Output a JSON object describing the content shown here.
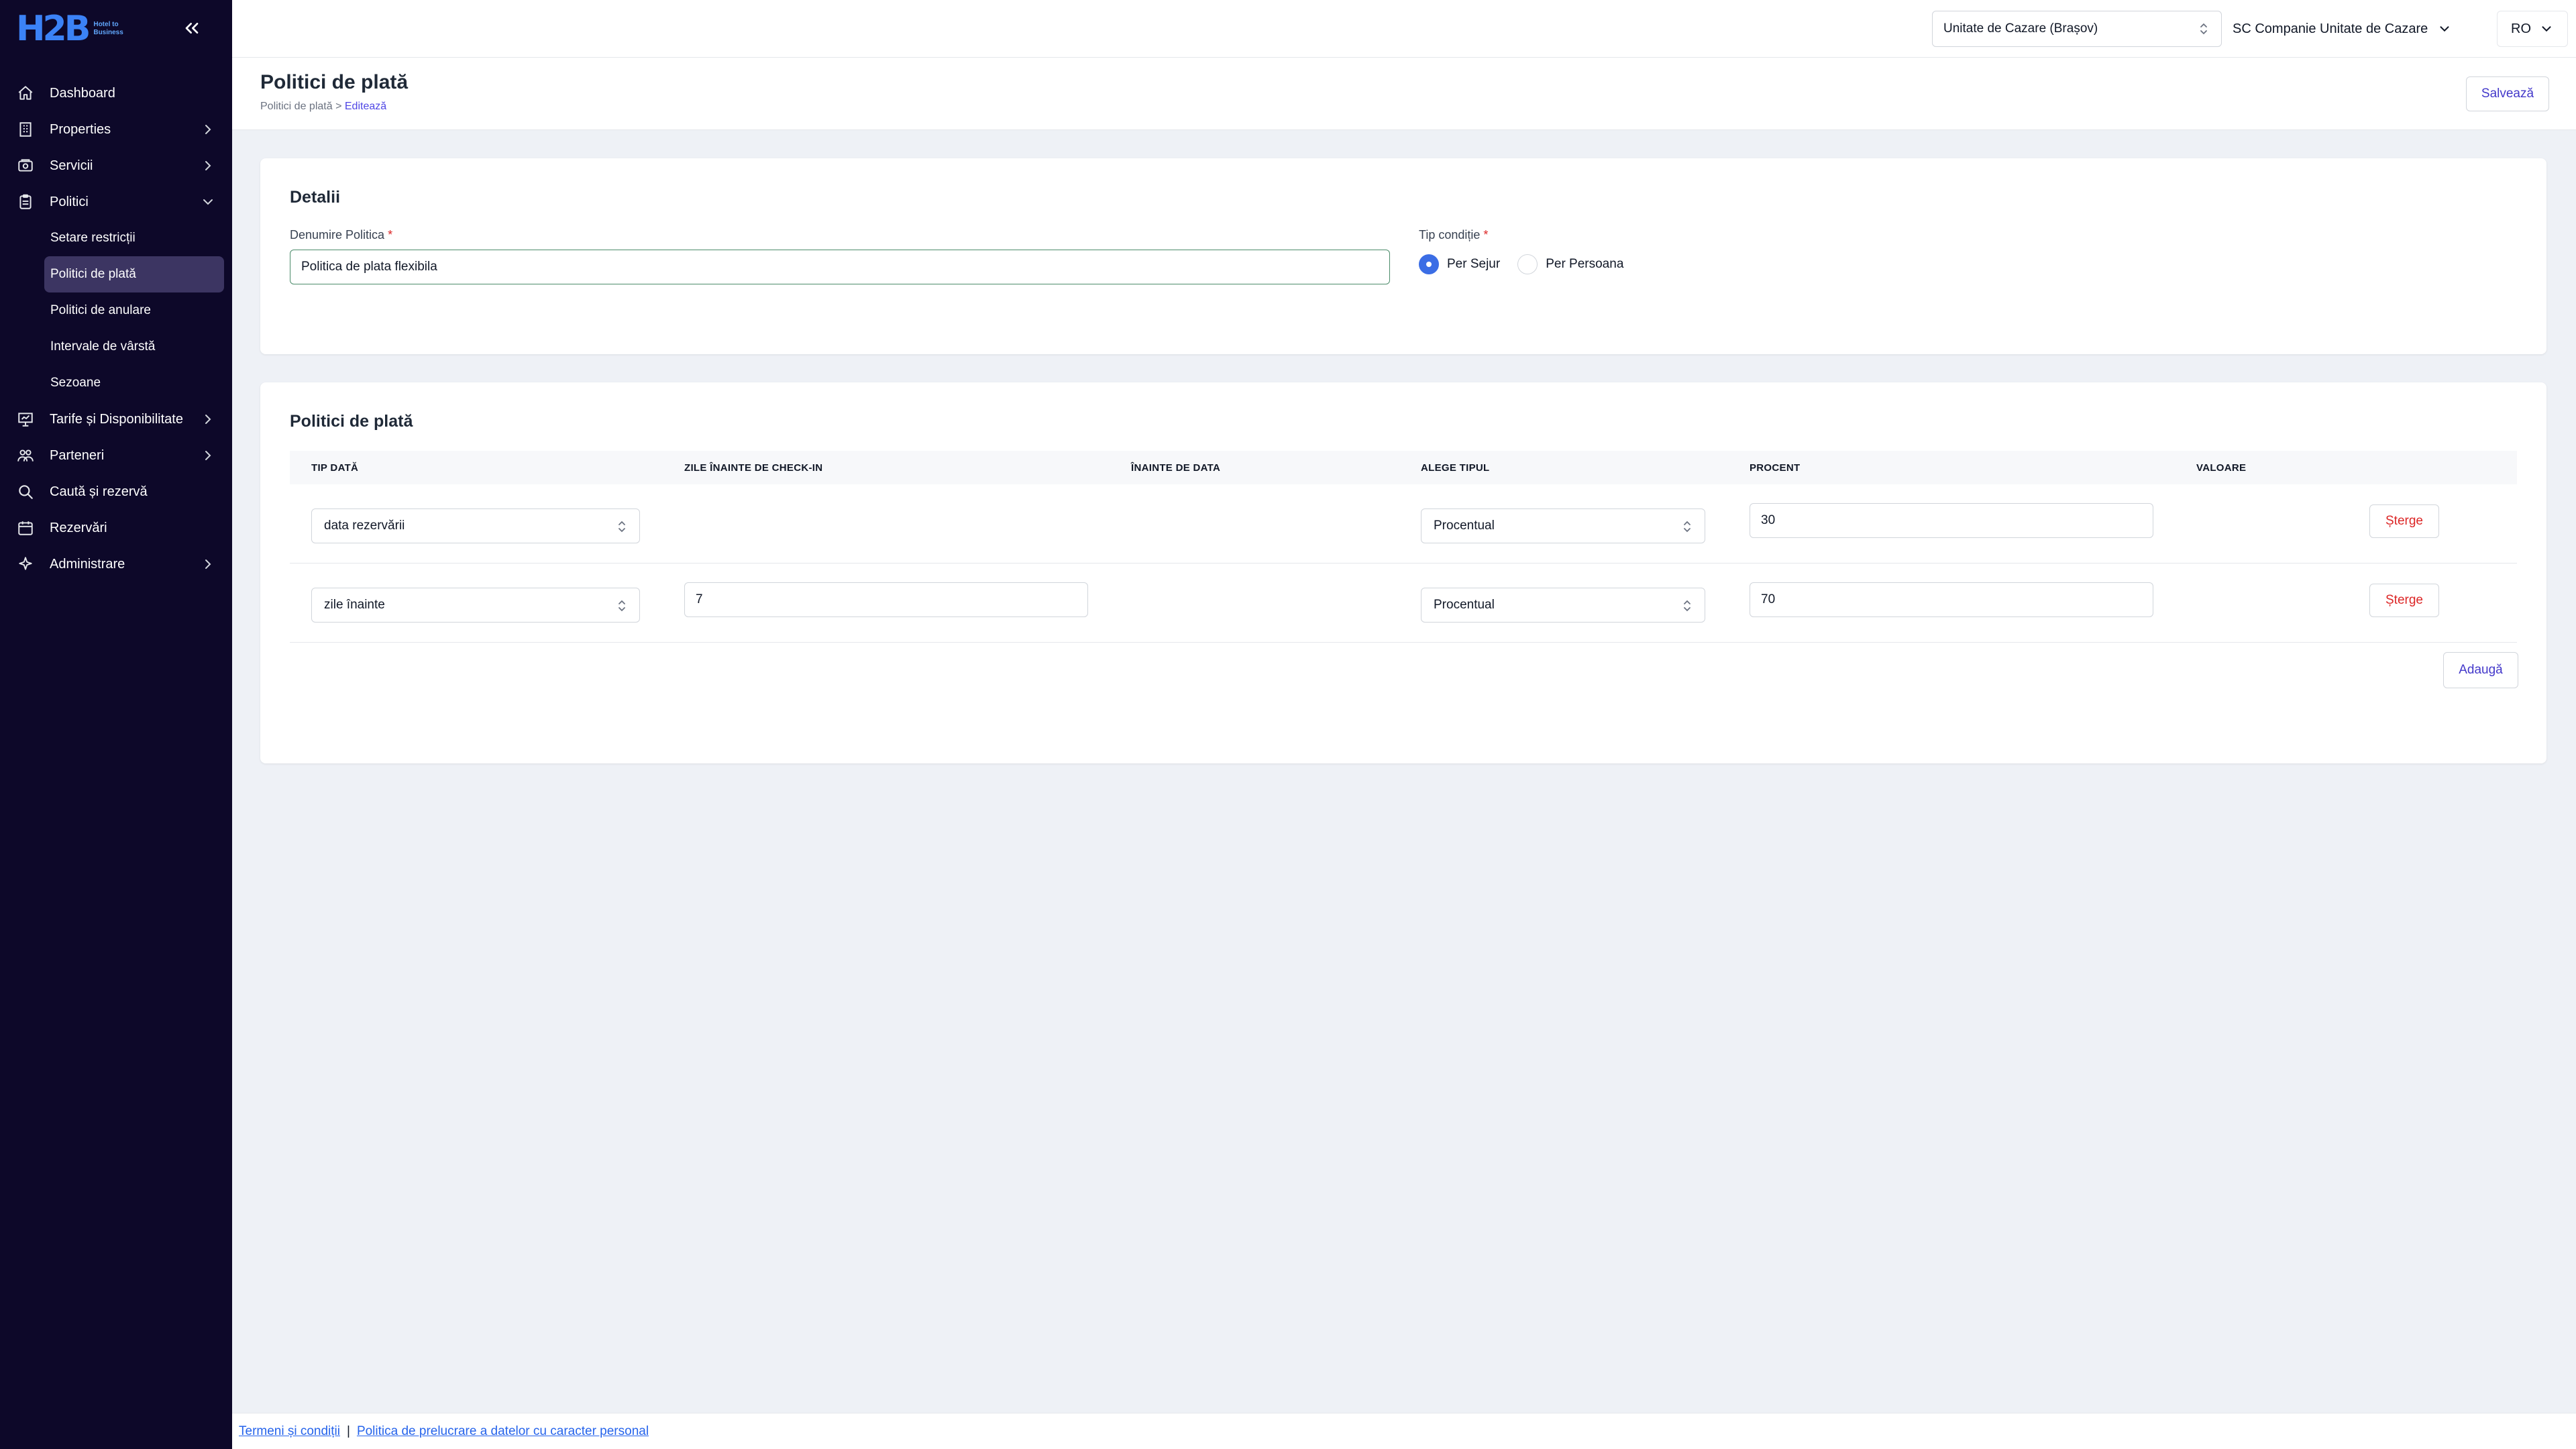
{
  "brand": {
    "logo": "H2B",
    "tagline": "Hotel to Business"
  },
  "sidebar": {
    "collapse_icon": "double-chevron-left-icon",
    "items": [
      {
        "label": "Dashboard",
        "icon": "home-icon"
      },
      {
        "label": "Properties",
        "icon": "building-icon"
      },
      {
        "label": "Servicii",
        "icon": "services-icon"
      },
      {
        "label": "Politici",
        "icon": "clipboard-icon",
        "expanded": true,
        "children": [
          {
            "label": "Setare restricții"
          },
          {
            "label": "Politici de plată",
            "active": true
          },
          {
            "label": "Politici de anulare"
          },
          {
            "label": "Intervale de vârstă"
          },
          {
            "label": "Sezoane"
          }
        ]
      },
      {
        "label": "Tarife și Disponibilitate",
        "icon": "presentation-icon"
      },
      {
        "label": "Parteneri",
        "icon": "partners-icon"
      },
      {
        "label": "Caută și rezervă",
        "icon": "search-icon"
      },
      {
        "label": "Rezervări",
        "icon": "calendar-icon"
      },
      {
        "label": "Administrare",
        "icon": "sparkle-icon"
      }
    ]
  },
  "topbar": {
    "unit_select": "Unitate de Cazare (Brașov)",
    "company": "SC Companie Unitate de Cazare",
    "language": "RO"
  },
  "page": {
    "title": "Politici de plată",
    "breadcrumb": {
      "parent": "Politici de plată",
      "separator": ">",
      "current": "Editează"
    },
    "save_label": "Salvează"
  },
  "details": {
    "title": "Detalii",
    "name_label": "Denumire Politica",
    "name_value": "Politica de plata flexibila",
    "condition_label": "Tip condiție",
    "required_mark": "*",
    "condition_options": [
      {
        "label": "Per Sejur",
        "checked": true
      },
      {
        "label": "Per Persoana",
        "checked": false
      }
    ]
  },
  "policies": {
    "title": "Politici de plată",
    "columns": [
      "TIP DATĂ",
      "ZILE ÎNAINTE DE CHECK-IN",
      "ÎNAINTE DE DATA",
      "ALEGE TIPUL",
      "PROCENT",
      "VALOARE"
    ],
    "rows": [
      {
        "tip_data": "data rezervării",
        "zile": null,
        "tip": "Procentual",
        "procent": "30",
        "delete": "Șterge"
      },
      {
        "tip_data": "zile înainte",
        "zile": "7",
        "tip": "Procentual",
        "procent": "70",
        "delete": "Șterge"
      }
    ],
    "add_label": "Adaugă"
  },
  "footer": {
    "terms": "Termeni și condiții",
    "separator": "|",
    "privacy": "Politica de prelucrare a datelor cu caracter personal"
  },
  "colors": {
    "sidebar_bg": "#0d0829",
    "active_item_bg": "#3c3562",
    "accent": "#4338ca",
    "danger": "#dc2626",
    "radio_checked": "#3b6de5"
  }
}
